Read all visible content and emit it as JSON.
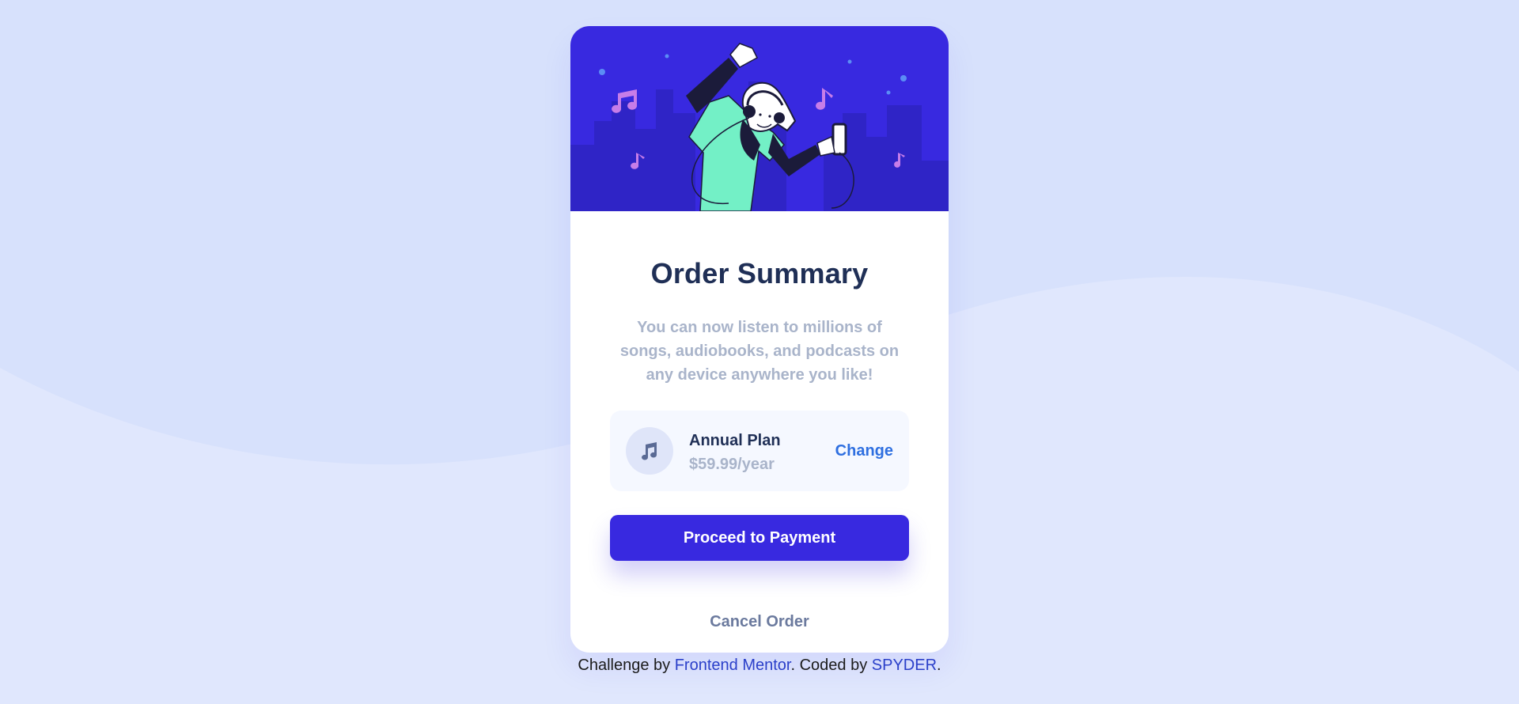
{
  "colors": {
    "background": "#d7e1fc",
    "accent": "#3829e0",
    "heading": "#1f2f56",
    "muted": "#a9b4ca",
    "link": "#2e6fe0",
    "hero_figure_shirt": "#73f0c6",
    "hero_notes": "#c77de8"
  },
  "icons": {
    "plan": "music-note-icon"
  },
  "card": {
    "title": "Order Summary",
    "description": "You can now listen to millions of songs, audiobooks, and podcasts on any device anywhere you like!",
    "plan": {
      "name": "Annual Plan",
      "price": "$59.99/year",
      "change_label": "Change"
    },
    "proceed_label": "Proceed to Payment",
    "cancel_label": "Cancel Order"
  },
  "attribution": {
    "prefix": "Challenge by ",
    "challenge_link": "Frontend Mentor",
    "middle": ". Coded by ",
    "author_link": "SPYDER",
    "suffix": "."
  }
}
